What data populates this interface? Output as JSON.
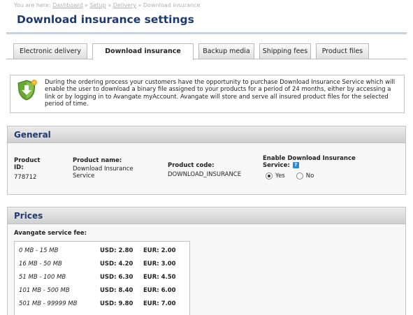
{
  "breadcrumb": {
    "prefix": "You are here:",
    "items": [
      "Dashboard",
      "Setup",
      "Delivery"
    ],
    "current": "Download insurance",
    "separator": "»"
  },
  "page_title": "Download insurance settings",
  "tabs": [
    {
      "label": "Electronic delivery",
      "active": false
    },
    {
      "label": "Download insurance",
      "active": true
    },
    {
      "label": "Backup media",
      "active": false
    },
    {
      "label": "Shipping fees",
      "active": false
    },
    {
      "label": "Product files",
      "active": false
    }
  ],
  "info": {
    "icon": "shield-download-icon",
    "text": "During the ordering process your customers have the opportunity to purchase Download Insurance Service which will enable the user to download a binary file assigned to your products for a period of 24 months, either by accessing a link or by logging in to Avangate myAccount. Avangate will store and serve all insured product files for the selected period of time."
  },
  "general": {
    "title": "General",
    "product_id_label": "Product ID:",
    "product_id": "778712",
    "product_name_label": "Product name:",
    "product_name": "Download Insurance Service",
    "product_code_label": "Product code:",
    "product_code": "DOWNLOAD_INSURANCE",
    "enable_label": "Enable Download Insurance Service:",
    "help": "?",
    "yes_label": "Yes",
    "no_label": "No",
    "selected": "Yes"
  },
  "prices": {
    "title": "Prices",
    "fee_label": "Avangate service fee:",
    "rows": [
      {
        "range": "0 MB - 15 MB",
        "usd": "USD: 2.80",
        "eur": "EUR: 2.00"
      },
      {
        "range": "16 MB - 50 MB",
        "usd": "USD: 4.20",
        "eur": "EUR: 3.00"
      },
      {
        "range": "51 MB - 100 MB",
        "usd": "USD: 6.30",
        "eur": "EUR: 4.50"
      },
      {
        "range": "101 MB - 500 MB",
        "usd": "USD: 8.40",
        "eur": "EUR: 6.00"
      },
      {
        "range": "501 MB - 99999 MB",
        "usd": "USD: 9.80",
        "eur": "EUR: 7.00"
      }
    ]
  },
  "colors": {
    "title": "#1e3a6e",
    "help_icon": "#2f8ad4",
    "shield": "#6aa535"
  }
}
